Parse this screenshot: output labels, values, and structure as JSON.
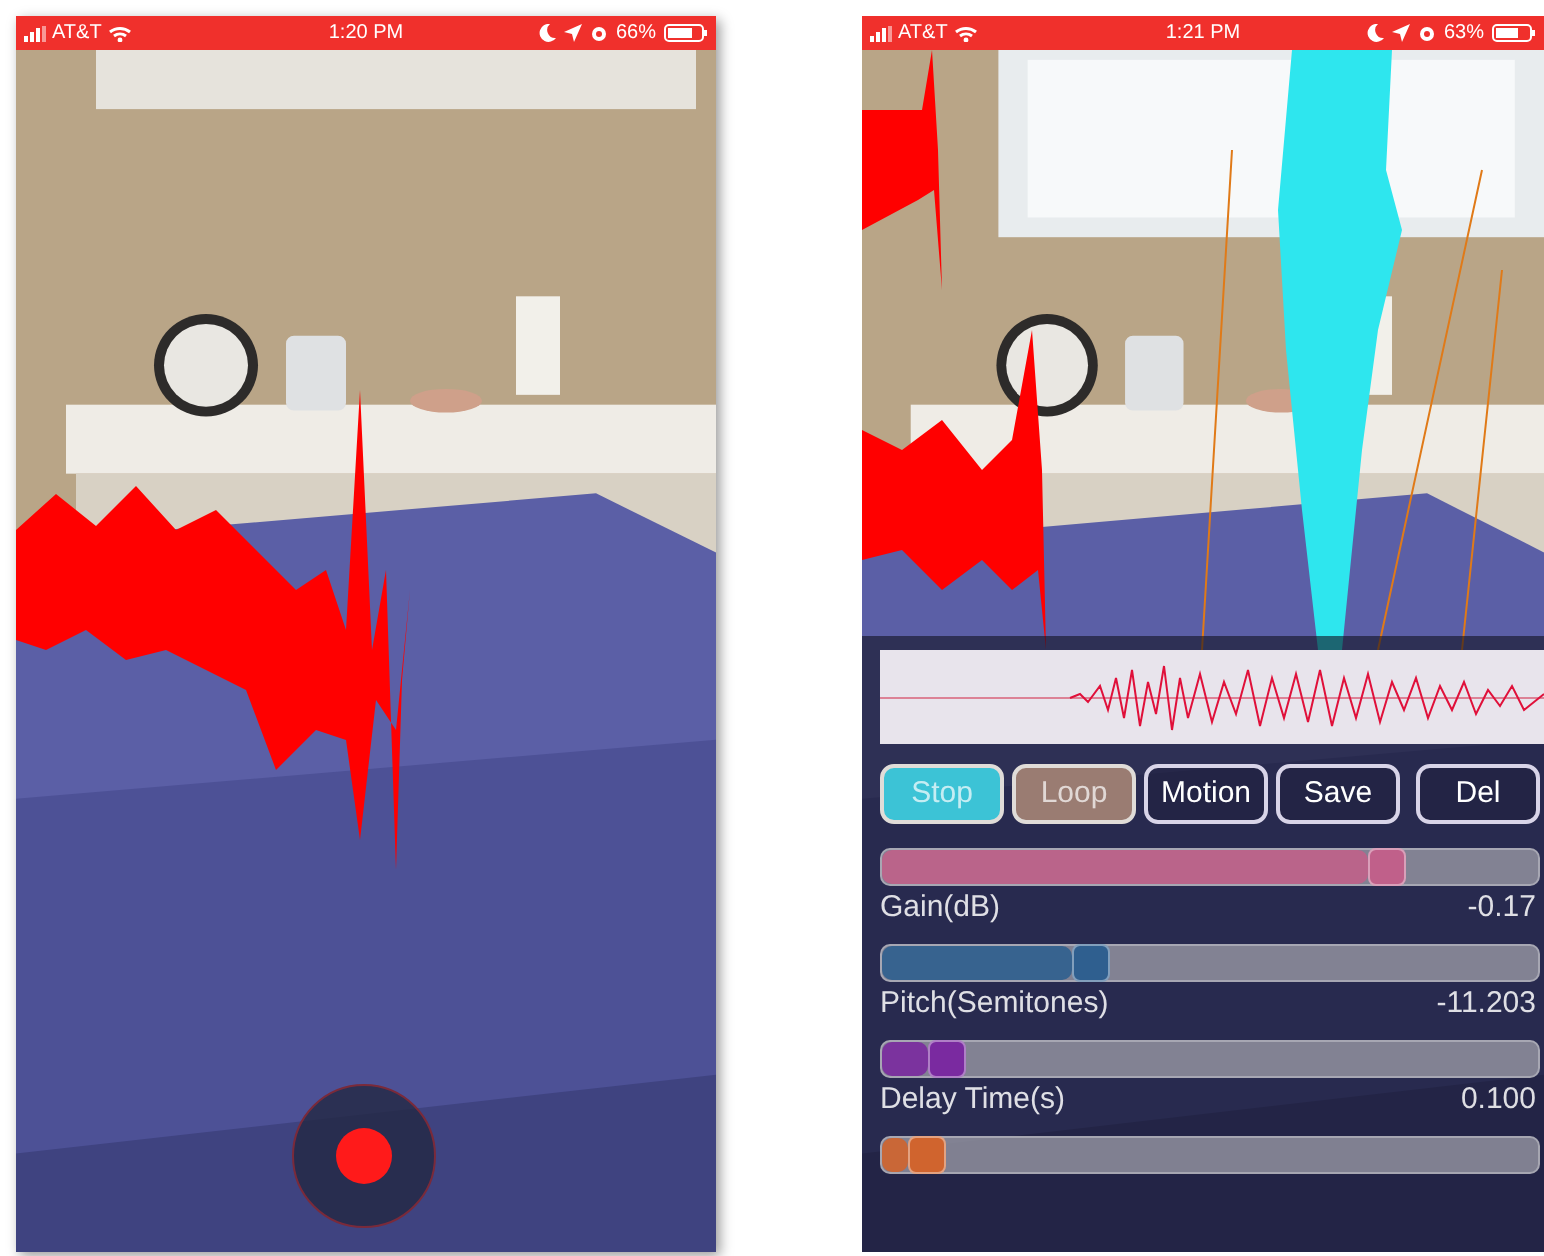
{
  "phones": [
    {
      "kind": "recorder",
      "status_bar": {
        "carrier": "AT&T",
        "time": "1:20 PM",
        "battery": "66%"
      }
    },
    {
      "kind": "editor",
      "status_bar": {
        "carrier": "AT&T",
        "time": "1:21 PM",
        "battery": "63%"
      },
      "buttons": [
        {
          "label": "Stop",
          "on": true,
          "color": "#3cc3d6"
        },
        {
          "label": "Loop",
          "on": true,
          "color": "#9a7c72"
        },
        {
          "label": "Motion",
          "on": false
        },
        {
          "label": "Save",
          "on": false
        },
        {
          "label": "Del",
          "on": false
        }
      ],
      "sliders": [
        {
          "label": "Gain(dB)",
          "reading": "-0.17",
          "level": 0.74,
          "color": "#c0608a"
        },
        {
          "label": "Pitch(Semitones)",
          "reading": "-11.203",
          "level": 0.29,
          "color": "#2f5f8f"
        },
        {
          "label": "Delay Time(s)",
          "reading": "0.100",
          "level": 0.07,
          "color": "#7a2aa0"
        },
        {
          "level": 0.04,
          "color": "#d0642e"
        }
      ]
    }
  ]
}
